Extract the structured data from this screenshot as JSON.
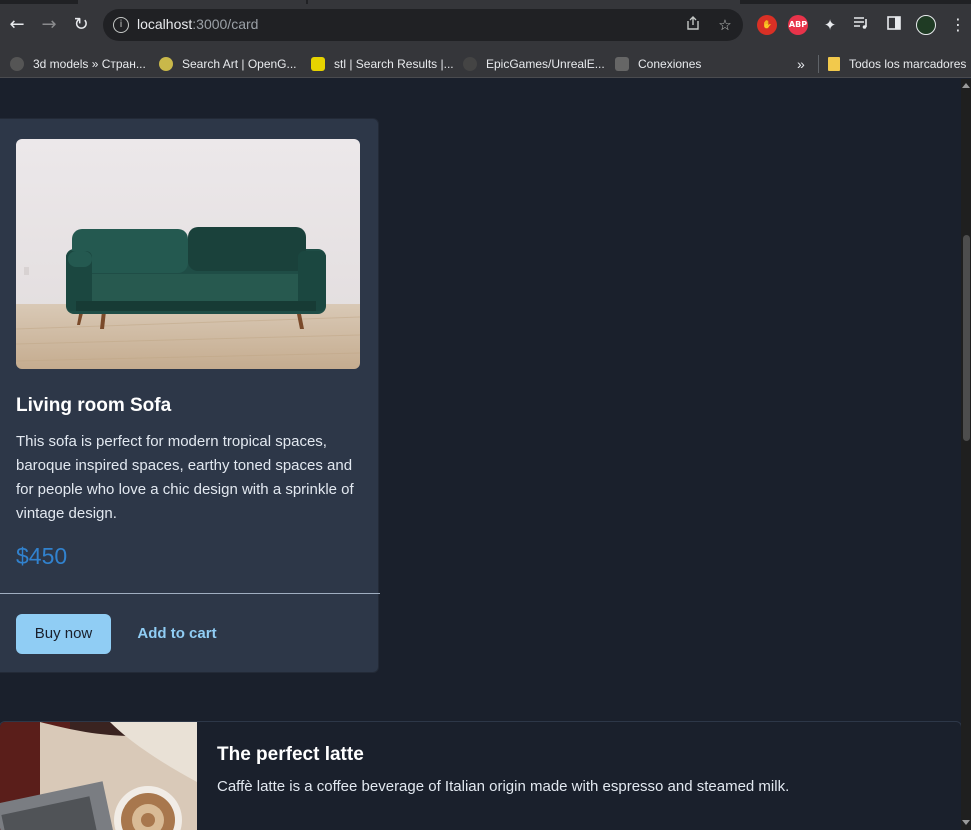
{
  "browser": {
    "url_host": "localhost",
    "url_path": ":3000/card",
    "bookmarks": [
      {
        "label": "3d models » Стран...",
        "icon": "sketchfab-icon"
      },
      {
        "label": "Search Art | OpenG...",
        "icon": "opengameart-icon"
      },
      {
        "label": "stl | Search Results |...",
        "icon": "thingiverse-icon"
      },
      {
        "label": "EpicGames/UnrealE...",
        "icon": "github-icon"
      },
      {
        "label": "Conexiones",
        "icon": "conexiones-icon"
      }
    ],
    "all_bookmarks_label": "Todos los marcadores",
    "extensions": [
      {
        "label": "",
        "icon": "stop-hand-icon",
        "color": "#d93025"
      },
      {
        "label": "ABP",
        "icon": "adblock-plus-icon",
        "color": "#e8334a"
      }
    ]
  },
  "card": {
    "title": "Living room Sofa",
    "description": "This sofa is perfect for modern tropical spaces, baroque inspired spaces, earthy toned spaces and for people who love a chic design with a sprinkle of vintage design.",
    "price": "$450",
    "buy_label": "Buy now",
    "cart_label": "Add to cart"
  },
  "horizontal_card": {
    "title": "The perfect latte",
    "description": "Caffè latte is a coffee beverage of Italian origin made with espresso and steamed milk."
  },
  "colors": {
    "page_bg": "#1a202c",
    "card_bg": "#2d3748",
    "price": "#3182ce",
    "button_bg": "#90cdf4",
    "link": "#90cdf4"
  }
}
